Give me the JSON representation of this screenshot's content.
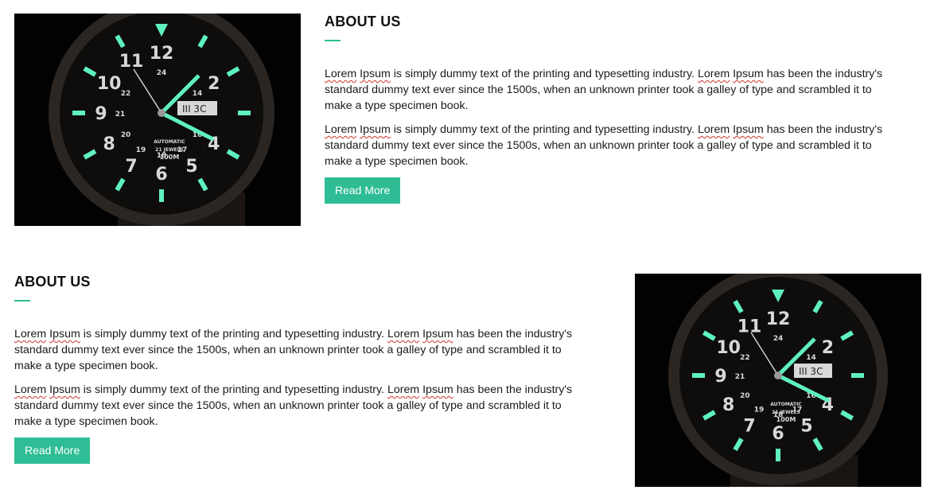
{
  "sections": [
    {
      "heading": "ABOUT US",
      "paragraphs": [
        {
          "w1": "Lorem",
          "w2": "Ipsum",
          "t1": " is simply dummy text of the printing and typesetting industry. ",
          "w3": "Lorem",
          "w4": "Ipsum",
          "t2": " has been the industry's standard dummy text ever since the 1500s, when an unknown printer took a galley of type and scrambled it to make a type specimen book."
        },
        {
          "w1": "Lorem",
          "w2": "Ipsum",
          "t1": " is simply dummy text of the printing and typesetting industry. ",
          "w3": "Lorem",
          "w4": "Ipsum",
          "t2": " has been the industry's standard dummy text ever since the 1500s, when an unknown printer took a galley of type and scrambled it to make a type specimen book."
        }
      ],
      "button_label": "Read More"
    },
    {
      "heading": "ABOUT US",
      "paragraphs": [
        {
          "w1": "Lorem",
          "w2": "Ipsum",
          "t1": " is simply dummy text of the printing and typesetting industry. ",
          "w3": "Lorem",
          "w4": "Ipsum",
          "t2": " has been the industry's standard dummy text ever since the 1500s, when an unknown printer took a galley of type and scrambled it to make a type specimen book."
        },
        {
          "w1": "Lorem",
          "w2": "Ipsum",
          "t1": " is simply dummy text of the printing and typesetting industry. ",
          "w3": "Lorem",
          "w4": "Ipsum",
          "t2": " has been the industry's standard dummy text ever since the 1500s, when an unknown printer took a galley of type and scrambled it to make a type specimen book."
        }
      ],
      "button_label": "Read More"
    }
  ],
  "watch_image": {
    "dial_numbers": [
      "12",
      "2",
      "4",
      "5",
      "6",
      "7",
      "8",
      "9",
      "10",
      "11"
    ],
    "inner_numbers": [
      "24",
      "14",
      "16",
      "17",
      "18",
      "19",
      "20",
      "21",
      "22"
    ],
    "date_window": "III 3C",
    "brand_lines": [
      "AUTOMATIC",
      "21 JEWELS",
      "100M"
    ]
  },
  "colors": {
    "accent": "#2ebd94",
    "lume": "#5ff0c0",
    "spellcheck": "#d0312d"
  }
}
